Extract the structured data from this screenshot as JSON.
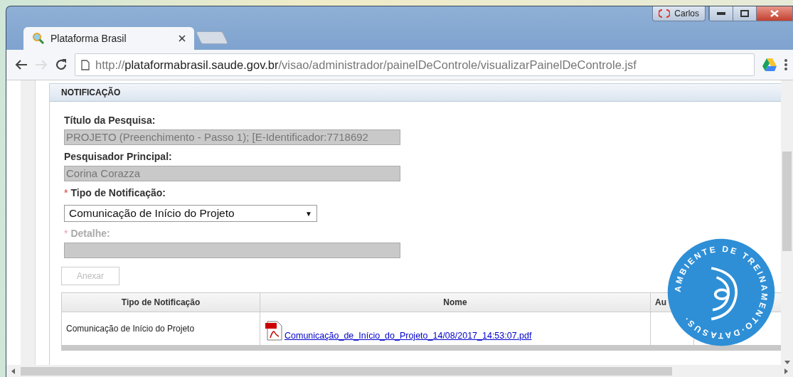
{
  "window": {
    "profile": "Carlos"
  },
  "tabs": [
    {
      "title": "Plataforma Brasil",
      "selected": true
    }
  ],
  "address_bar": {
    "scheme": "http://",
    "host": "plataformabrasil.saude.gov.br",
    "path": "/visao/administrador/painelDeControle/visualizarPainelDeControle.jsf"
  },
  "panel": {
    "title": "NOTIFICAÇÃO",
    "fields": [
      {
        "kind": "text",
        "label": "Título da Pesquisa:",
        "required": false,
        "disabled": true,
        "value": "PROJETO (Preenchimento - Passo 1); [E-Identificador:7718692"
      },
      {
        "kind": "text",
        "label": "Pesquisador Principal:",
        "required": false,
        "disabled": true,
        "value": "Corina Corazza"
      },
      {
        "kind": "select",
        "label": "Tipo de Notificação:",
        "required": true,
        "disabled": false,
        "value": "Comunicação de Início do Projeto",
        "arrow": "▼"
      },
      {
        "kind": "text",
        "label": "Detalhe:",
        "required": true,
        "disabled": true
      }
    ],
    "required_mark": "*",
    "attach_button": {
      "label": "Anexar",
      "disabled": true
    },
    "table": {
      "columns": [
        "Tipo de Notificação",
        "Nome",
        "Au",
        ""
      ],
      "rows": [
        {
          "tipo": "Comunicação de Início do Projeto",
          "file": "Comunicação_de_Início_do_Projeto_14/08/2017_14:53:07.pdf"
        }
      ]
    }
  },
  "seal": {
    "ring_text": "AMBIENTE DE TREINAMENTO·DATASUS·"
  }
}
